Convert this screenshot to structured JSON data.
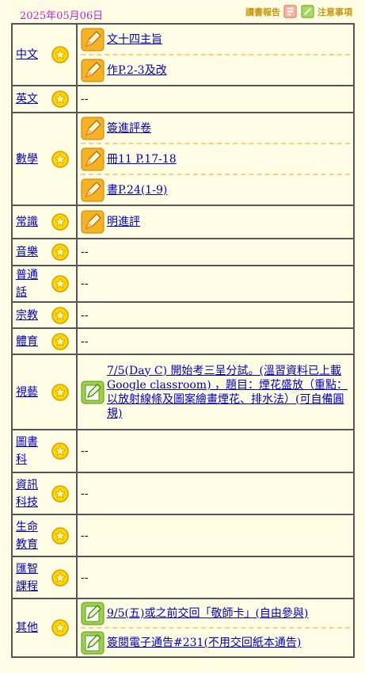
{
  "header": {
    "date": "2025年05月06日",
    "report_label": "讀書報告",
    "notice_label": "注意事項"
  },
  "rows": [
    {
      "subject": "中文",
      "items": [
        "文十四主旨",
        "作P.2-3及改"
      ]
    },
    {
      "subject": "英文",
      "empty": "--"
    },
    {
      "subject": "數學",
      "items": [
        "簽進評卷",
        "冊11 P.17-18",
        "書P.24(1-9)"
      ]
    },
    {
      "subject": "常識",
      "items": [
        "明進評"
      ]
    },
    {
      "subject": "音樂",
      "empty": "--"
    },
    {
      "subject": "普通話",
      "empty": "--"
    },
    {
      "subject": "宗教",
      "empty": "--"
    },
    {
      "subject": "體育",
      "empty": "--"
    },
    {
      "subject": "視藝",
      "notices": [
        "7/5(Day C) 開始考三呈分試。(溫習資料已上載Google classroom) ，題目：煙花盛放（重點：以放射線條及圖案繪畫煙花、排水法）(可自備圓規)"
      ]
    },
    {
      "subject": "圖書科",
      "empty": "--"
    },
    {
      "subject": "資訊科技",
      "empty": "--"
    },
    {
      "subject": "生命教育",
      "empty": "--"
    },
    {
      "subject": "匯智課程",
      "empty": "--"
    },
    {
      "subject": "其他",
      "notices": [
        "9/5(五)或之前交回「敬師卡」(自由參與)",
        "簽閱電子通告#231(不用交回紙本通告)"
      ]
    }
  ],
  "icons": {
    "subject_star": "star-icon",
    "homework": "pencil-homework-icon",
    "notice": "pencil-notice-icon",
    "accent": "#c8960c"
  }
}
